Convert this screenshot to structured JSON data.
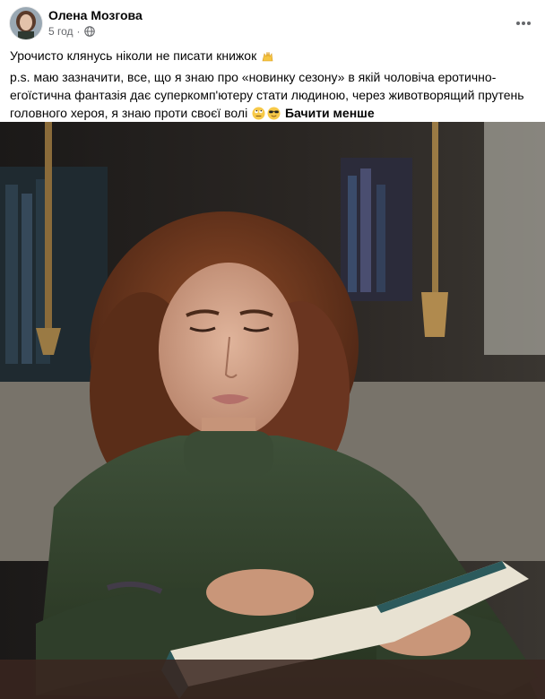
{
  "post": {
    "author": "Олена Мозгова",
    "time": "5 год",
    "separator": "·",
    "privacy_icon": "globe-icon",
    "more_icon": "more-horizontal-icon",
    "text_line1": "Урочисто клянусь ніколи не писати книжок",
    "text_line1_emoji": "raised-hands-emoji",
    "text_body": "p.s. маю зазначити, все, що я знаю про «новинку сезону» в якій чоловіча еротично-егоїстична фантазія дає суперкомп'ютеру стати людиною, через животворящий прутень головного хероя, я знаю проти своєї волі",
    "text_body_emojis": [
      "rolling-eyes-emoji",
      "sunglasses-emoji"
    ],
    "see_less_label": "Бачити менше"
  },
  "photo": {
    "description_icon": "woman-reading-book-photo",
    "subject_colors": {
      "sweater": "#3a4a36",
      "hair": "#7a3f22",
      "background": "#1e1c1a"
    }
  },
  "colors": {
    "text_primary": "#050505",
    "text_secondary": "#65676b",
    "background": "#ffffff"
  }
}
